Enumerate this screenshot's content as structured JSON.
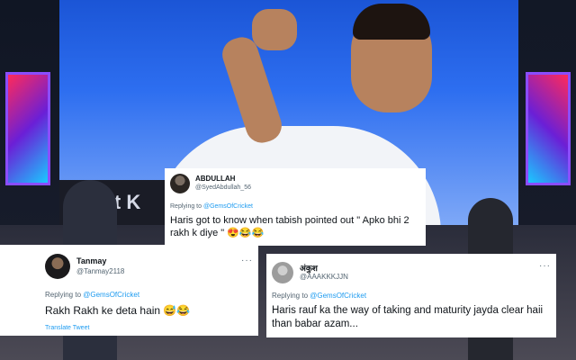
{
  "background": {
    "caption": "irat K"
  },
  "tweets": [
    {
      "id": "t1",
      "name": "ABDULLAH",
      "handle": "@SyedAbdullah_56",
      "replying_prefix": "Replying to ",
      "replying_mention": "@GemsOfCricket",
      "text": "Haris got to know when tabish pointed out  \" Apko bhi 2 rakh k diye \" 😍😂😂"
    },
    {
      "id": "t2",
      "name": "Tanmay",
      "handle": "@Tanmay2118",
      "more": "···",
      "replying_prefix": "Replying to ",
      "replying_mention": "@GemsOfCricket",
      "text": "Rakh Rakh ke deta hain 😅😂",
      "translate": "Translate Tweet"
    },
    {
      "id": "t3",
      "name": "अंकुश",
      "handle": "@AAAKKKJJN",
      "more": "···",
      "replying_prefix": "Replying to ",
      "replying_mention": "@GemsOfCricket",
      "text": "Haris rauf ka the way of taking and maturity jayda clear haii than babar azam..."
    }
  ],
  "colors": {
    "link": "#1d9bf0",
    "secondary_text": "#536471",
    "primary_text": "#0f1419",
    "card_bg": "#ffffff"
  }
}
